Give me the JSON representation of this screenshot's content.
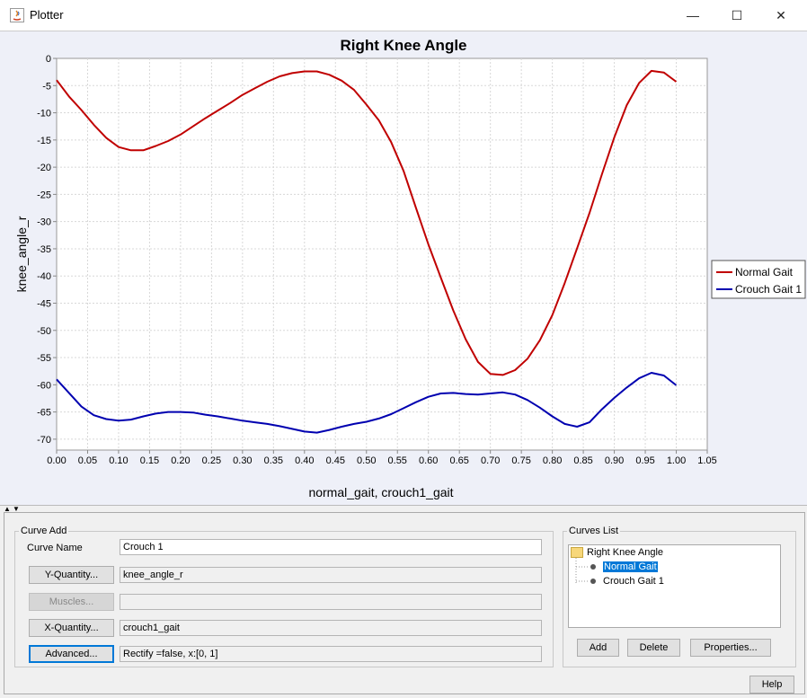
{
  "window": {
    "title": "Plotter",
    "minimize": "—",
    "maximize": "☐",
    "close": "✕"
  },
  "chart_data": {
    "type": "line",
    "title": "Right Knee Angle",
    "xlabel": "normal_gait, crouch1_gait",
    "ylabel": "knee_angle_r",
    "xlim": [
      0.0,
      1.05
    ],
    "ylim": [
      -72,
      0
    ],
    "xticks": [
      "0.00",
      "0.05",
      "0.10",
      "0.15",
      "0.20",
      "0.25",
      "0.30",
      "0.35",
      "0.40",
      "0.45",
      "0.50",
      "0.55",
      "0.60",
      "0.65",
      "0.70",
      "0.75",
      "0.80",
      "0.85",
      "0.90",
      "0.95",
      "1.00",
      "1.05"
    ],
    "yticks": [
      "0",
      "-5",
      "-10",
      "-15",
      "-20",
      "-25",
      "-30",
      "-35",
      "-40",
      "-45",
      "-50",
      "-55",
      "-60",
      "-65",
      "-70"
    ],
    "grid": true,
    "legend_position": "right",
    "series": [
      {
        "name": "Normal Gait",
        "color": "#c00000",
        "x": [
          0.0,
          0.02,
          0.04,
          0.06,
          0.08,
          0.1,
          0.12,
          0.14,
          0.16,
          0.18,
          0.2,
          0.22,
          0.24,
          0.26,
          0.28,
          0.3,
          0.32,
          0.34,
          0.36,
          0.38,
          0.4,
          0.42,
          0.44,
          0.46,
          0.48,
          0.5,
          0.52,
          0.54,
          0.56,
          0.58,
          0.6,
          0.62,
          0.64,
          0.66,
          0.68,
          0.7,
          0.72,
          0.74,
          0.76,
          0.78,
          0.8,
          0.82,
          0.84,
          0.86,
          0.88,
          0.9,
          0.92,
          0.94,
          0.96,
          0.98,
          1.0
        ],
        "y": [
          -4,
          -7,
          -9.5,
          -12.2,
          -14.6,
          -16.3,
          -16.9,
          -16.9,
          -16.1,
          -15.2,
          -14,
          -12.5,
          -11,
          -9.6,
          -8.2,
          -6.7,
          -5.5,
          -4.3,
          -3.3,
          -2.7,
          -2.4,
          -2.4,
          -3,
          -4.1,
          -5.8,
          -8.5,
          -11.4,
          -15.4,
          -20.7,
          -27.5,
          -34.2,
          -40.3,
          -46.3,
          -51.6,
          -55.8,
          -58,
          -58.2,
          -57.3,
          -55.2,
          -51.8,
          -47.2,
          -41.3,
          -34.9,
          -28.4,
          -21.3,
          -14.5,
          -8.6,
          -4.5,
          -2.3,
          -2.6,
          -4.3
        ]
      },
      {
        "name": "Crouch Gait 1",
        "color": "#0000b0",
        "x": [
          0.0,
          0.02,
          0.04,
          0.06,
          0.08,
          0.1,
          0.12,
          0.14,
          0.16,
          0.18,
          0.2,
          0.22,
          0.24,
          0.26,
          0.28,
          0.3,
          0.32,
          0.34,
          0.36,
          0.38,
          0.4,
          0.42,
          0.44,
          0.46,
          0.48,
          0.5,
          0.52,
          0.54,
          0.56,
          0.58,
          0.6,
          0.62,
          0.64,
          0.66,
          0.68,
          0.7,
          0.72,
          0.74,
          0.76,
          0.78,
          0.8,
          0.82,
          0.84,
          0.86,
          0.88,
          0.9,
          0.92,
          0.94,
          0.96,
          0.98,
          1.0
        ],
        "y": [
          -59,
          -61.5,
          -64,
          -65.6,
          -66.3,
          -66.6,
          -66.4,
          -65.8,
          -65.3,
          -65,
          -65,
          -65.1,
          -65.5,
          -65.8,
          -66.2,
          -66.6,
          -66.9,
          -67.2,
          -67.6,
          -68.1,
          -68.6,
          -68.8,
          -68.3,
          -67.7,
          -67.2,
          -66.8,
          -66.2,
          -65.4,
          -64.3,
          -63.2,
          -62.2,
          -61.6,
          -61.5,
          -61.7,
          -61.8,
          -61.6,
          -61.4,
          -61.8,
          -62.8,
          -64.2,
          -65.8,
          -67.2,
          -67.7,
          -66.9,
          -64.5,
          -62.4,
          -60.5,
          -58.8,
          -57.8,
          -58.3,
          -60.1
        ]
      }
    ]
  },
  "curve_add": {
    "legend": "Curve Add",
    "curve_name_label": "Curve Name",
    "curve_name_value": "Crouch 1",
    "y_quantity_button": "Y-Quantity...",
    "y_quantity_value": "knee_angle_r",
    "muscles_button": "Muscles...",
    "muscles_value": "",
    "x_quantity_button": "X-Quantity...",
    "x_quantity_value": "crouch1_gait",
    "advanced_button": "Advanced...",
    "advanced_value": "Rectify =false, x:[0, 1]"
  },
  "curves_list": {
    "legend": "Curves List",
    "root": "Right Knee Angle",
    "items": [
      "Normal Gait",
      "Crouch Gait 1"
    ],
    "add_button": "Add",
    "delete_button": "Delete",
    "properties_button": "Properties..."
  },
  "help_button": "Help"
}
